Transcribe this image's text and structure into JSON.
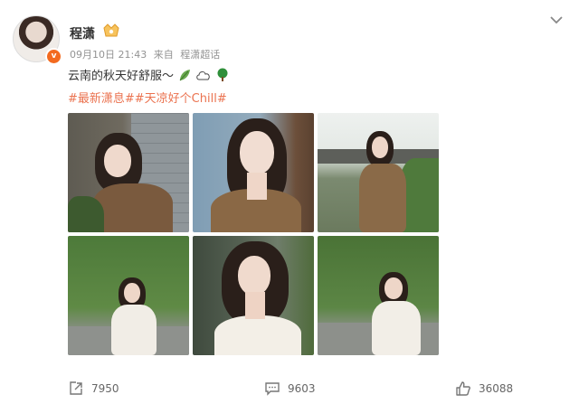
{
  "post": {
    "username": "程潇",
    "date": "09月10日 21:43",
    "source_prefix": "来自",
    "source": "程潇超话",
    "text": "云南的秋天好舒服～",
    "hashtags": "#最新潇息##天凉好个Chill#",
    "emojis": [
      "leaf-emoji",
      "cloud-emoji",
      "tree-emoji"
    ],
    "images": [
      {
        "name": "photo-1-stone-wall-braid"
      },
      {
        "name": "photo-2-blue-wall-portrait"
      },
      {
        "name": "photo-3-garden-brown-dress"
      },
      {
        "name": "photo-4-greenery-sitting"
      },
      {
        "name": "photo-5-closeup-white-dress"
      },
      {
        "name": "photo-6-stone-bench-sitting"
      }
    ]
  },
  "actions": {
    "share_count": "7950",
    "comment_count": "9603",
    "like_count": "36088"
  },
  "colors": {
    "accent": "#f36a1f",
    "hashtag": "#eb7350",
    "meta": "#939393"
  }
}
